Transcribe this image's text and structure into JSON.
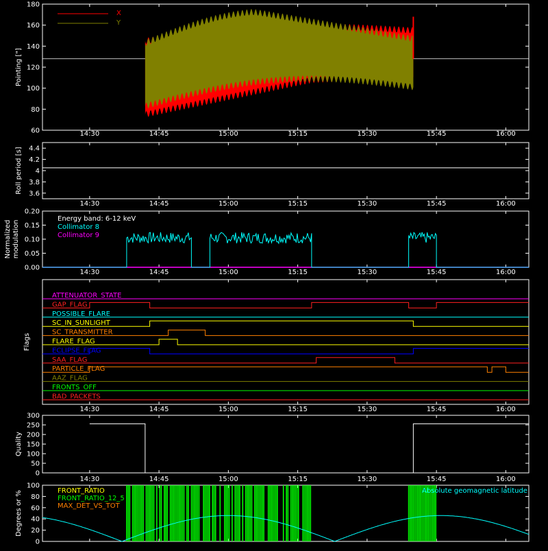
{
  "time_ticks": [
    "14:30",
    "14:45",
    "15:00",
    "15:15",
    "15:30",
    "15:45",
    "16:00"
  ],
  "time_range_min": [
    14.33,
    16.083
  ],
  "colors": {
    "x": "#ff0000",
    "y": "#808000",
    "white": "#ffffff",
    "cyan": "#00ffff",
    "magenta": "#ff00ff",
    "red": "#ff2020",
    "orange": "#ff8000",
    "yellow": "#ffff00",
    "blue": "#0000ff",
    "olive": "#808000",
    "green": "#00ff00"
  },
  "chart_data": [
    {
      "type": "line",
      "name": "pointing",
      "ylabel": "Pointing [\"]",
      "ylim": [
        60,
        180
      ],
      "yticks": [
        60,
        80,
        100,
        120,
        140,
        160,
        180
      ],
      "legend": [
        "X",
        "Y"
      ],
      "reference_line": 128,
      "active_range": [
        "14:42",
        "15:40"
      ],
      "x_envelope": {
        "start": [
          72,
          148
        ],
        "mid": [
          105,
          150
        ],
        "end": [
          108,
          158
        ]
      },
      "y_envelope": {
        "start": [
          80,
          146
        ],
        "peak_upper": 176,
        "end": [
          98,
          150
        ]
      }
    },
    {
      "type": "line",
      "name": "roll-period",
      "ylabel": "Roll period [s]",
      "ylim": [
        3.5,
        4.5
      ],
      "yticks": [
        3.6,
        3.8,
        4.0,
        4.2,
        4.4
      ],
      "value": 4.05
    },
    {
      "type": "line",
      "name": "modulation",
      "ylabel_lines": [
        "Normalized",
        "modulation"
      ],
      "ylim": [
        0.0,
        0.2
      ],
      "yticks": [
        "0.00",
        "0.05",
        "0.10",
        "0.15",
        "0.20"
      ],
      "annotation": "Energy band: 6-12 keV",
      "series": [
        {
          "name": "Collimator 8",
          "segments": [
            [
              "14:38",
              "14:52"
            ],
            [
              "14:56",
              "15:18"
            ],
            [
              "15:39",
              "15:45"
            ]
          ],
          "level": 0.105
        },
        {
          "name": "Collimator 9",
          "level": 0.0
        }
      ]
    },
    {
      "type": "line",
      "name": "flags",
      "ylabel": "Flags",
      "flags": [
        {
          "name": "ATTENUATOR_STATE",
          "color": "magenta",
          "high": []
        },
        {
          "name": "GAP_FLAG",
          "color": "red",
          "high": [
            [
              "14:30",
              "14:43"
            ],
            [
              "15:18",
              "15:39"
            ],
            [
              "15:45",
              "16:05"
            ]
          ]
        },
        {
          "name": "POSSIBLE_FLARE",
          "color": "cyan",
          "high": []
        },
        {
          "name": "SC_IN_SUNLIGHT",
          "color": "yellow",
          "high": [
            [
              "14:43",
              "15:40"
            ]
          ]
        },
        {
          "name": "SC_TRANSMITTER",
          "color": "orange",
          "high": [
            [
              "14:47",
              "14:55"
            ]
          ]
        },
        {
          "name": "FLARE_FLAG",
          "color": "yellow",
          "high": [
            [
              "14:45",
              "14:49"
            ]
          ]
        },
        {
          "name": "ECLIPSE_FLAG",
          "color": "blue",
          "high": [
            [
              "14:30",
              "14:43"
            ],
            [
              "15:40",
              "16:05"
            ]
          ]
        },
        {
          "name": "SAA_FLAG",
          "color": "red",
          "high": [
            [
              "15:19",
              "15:36"
            ]
          ]
        },
        {
          "name": "PARTICLE_FLAG",
          "color": "orange",
          "high": [
            [
              "14:30",
              "15:56"
            ],
            [
              "15:57",
              "16:00"
            ]
          ]
        },
        {
          "name": "AAZ_FLAG",
          "color": "olive",
          "high": []
        },
        {
          "name": "FRONTS_OFF",
          "color": "green",
          "high": []
        },
        {
          "name": "BAD_PACKETS",
          "color": "red",
          "high": []
        }
      ]
    },
    {
      "type": "line",
      "name": "quality",
      "ylabel": "Quality",
      "ylim": [
        0,
        300
      ],
      "yticks": [
        0,
        50,
        100,
        150,
        200,
        250,
        300
      ],
      "segments": [
        {
          "range": [
            "14:30",
            "14:42"
          ],
          "value": 256
        },
        {
          "range": [
            "14:42",
            "15:40"
          ],
          "value": 0
        },
        {
          "range": [
            "15:40",
            "16:05"
          ],
          "value": 256
        }
      ]
    },
    {
      "type": "line",
      "name": "ratios",
      "ylabel": "Degrees or %",
      "ylim": [
        0,
        100
      ],
      "yticks": [
        0,
        20,
        40,
        60,
        80,
        100
      ],
      "annotation": "Absolute geomagnetic latitude",
      "series": [
        {
          "name": "FRONT_RATIO",
          "color": "yellow"
        },
        {
          "name": "FRONT_RATIO_12_5",
          "color": "green",
          "segments": [
            [
              "14:38",
              "15:18"
            ],
            [
              "15:39",
              "15:45"
            ]
          ]
        },
        {
          "name": "MAX_DET_VS_TOT",
          "color": "orange"
        }
      ],
      "latitude": {
        "max": 46,
        "min": 0,
        "first_min": "14:37",
        "peak1": "15:00",
        "second_min": "15:23",
        "peak2": "15:47"
      }
    }
  ]
}
